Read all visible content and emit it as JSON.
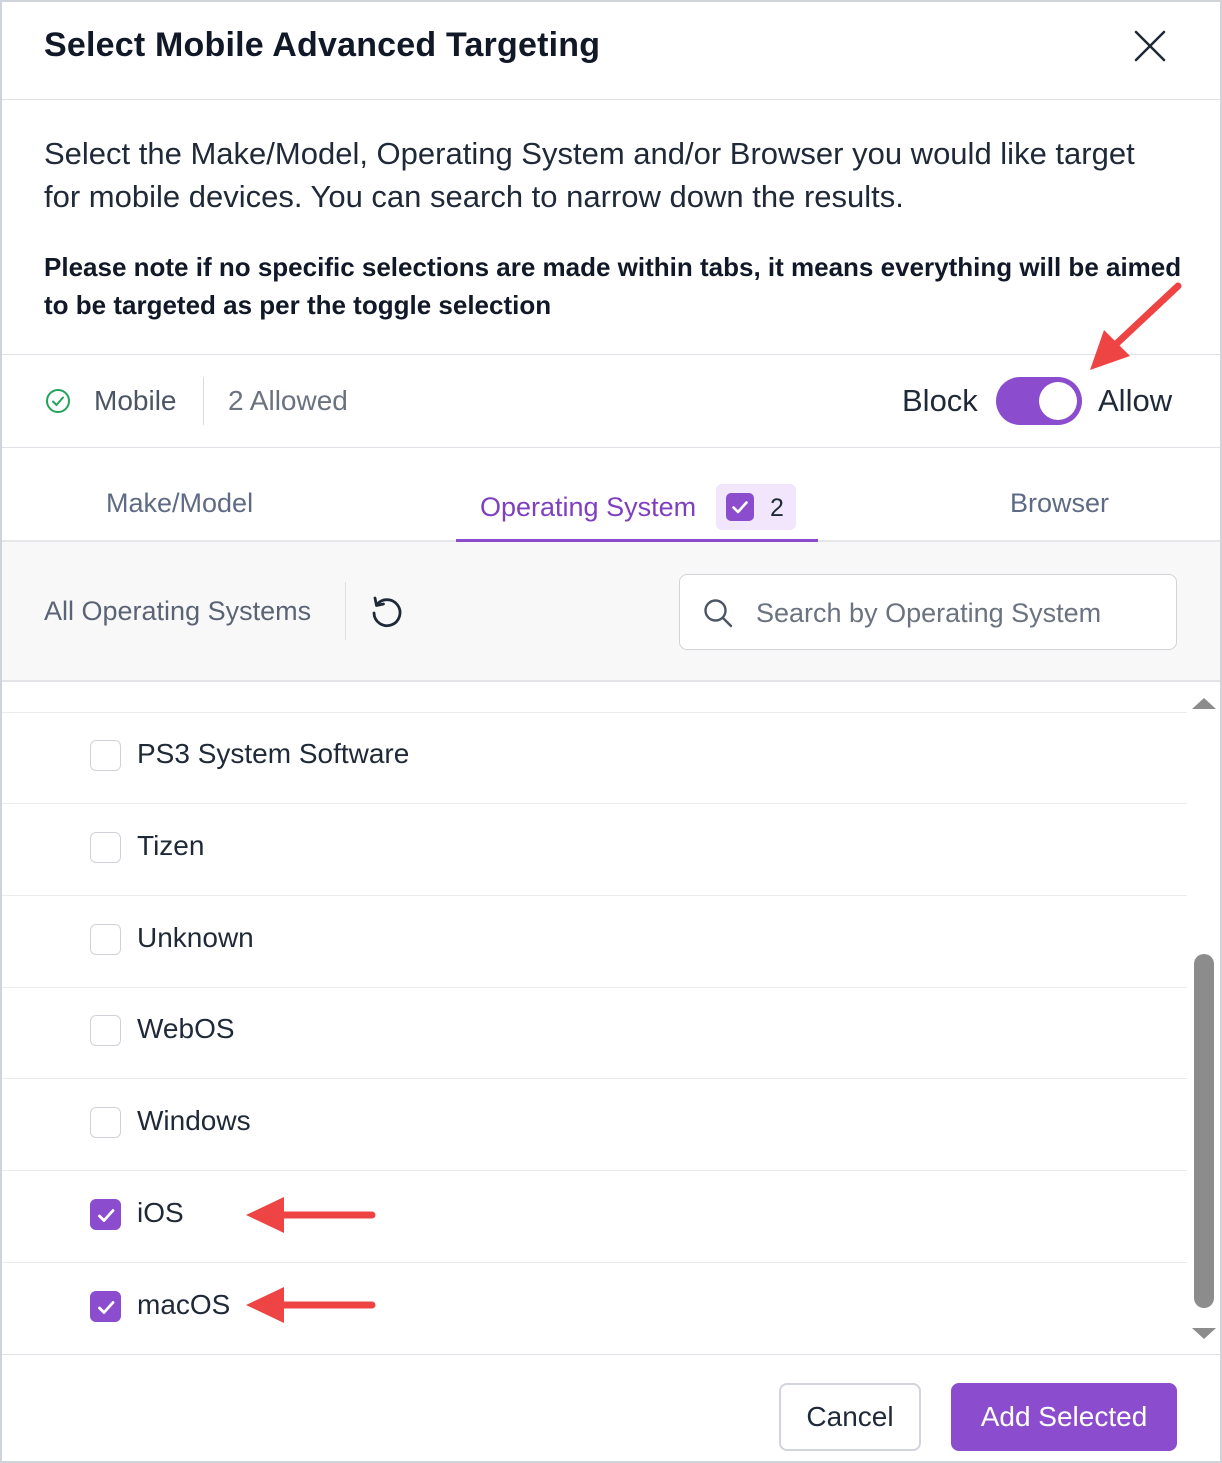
{
  "modal": {
    "title": "Select Mobile Advanced Targeting",
    "description": "Select the Make/Model, Operating System and/or Browser you would like target for mobile devices. You can search to narrow down the results.",
    "note": "Please note if no specific selections are made within tabs, it means everything will be aimed to be targeted as per the toggle selection"
  },
  "status": {
    "device_label": "Mobile",
    "allowed_text": "2 Allowed",
    "block_label": "Block",
    "allow_label": "Allow",
    "toggle_state": "Allow"
  },
  "tabs": [
    {
      "label": "Make/Model",
      "active": false
    },
    {
      "label": "Operating System",
      "active": true,
      "badge_count": "2"
    },
    {
      "label": "Browser",
      "active": false
    }
  ],
  "toolbar": {
    "all_label": "All Operating Systems",
    "search_placeholder": "Search by Operating System"
  },
  "os_list": [
    {
      "label": "PS3 System Software",
      "checked": false
    },
    {
      "label": "Tizen",
      "checked": false
    },
    {
      "label": "Unknown",
      "checked": false
    },
    {
      "label": "WebOS",
      "checked": false
    },
    {
      "label": "Windows",
      "checked": false
    },
    {
      "label": "iOS",
      "checked": true
    },
    {
      "label": "macOS",
      "checked": true
    }
  ],
  "footer": {
    "cancel_label": "Cancel",
    "add_label": "Add Selected"
  },
  "colors": {
    "accent": "#8b4dce",
    "annotation_arrow": "#ef4444",
    "success": "#22a35a"
  },
  "icons": [
    "close-icon",
    "check-circle-icon",
    "reset-icon",
    "search-icon",
    "checkbox-check-icon",
    "scroll-up-icon",
    "scroll-down-icon"
  ]
}
